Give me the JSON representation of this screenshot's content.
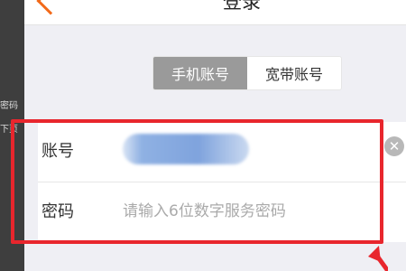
{
  "background_peek": [
    "密码",
    "下页"
  ],
  "header": {
    "title": "登录"
  },
  "tabs": [
    {
      "label": "手机账号",
      "active": true
    },
    {
      "label": "宽带账号",
      "active": false
    }
  ],
  "form": {
    "account": {
      "label": "账号",
      "value_obscured": true
    },
    "password": {
      "label": "密码",
      "placeholder": "请输入6位数字服务密码",
      "value": ""
    }
  },
  "colors": {
    "accent": "#f26a1a",
    "annotation": "#e8262d",
    "active_tab": "#9a9a9a",
    "page_bg": "#efeff4"
  }
}
